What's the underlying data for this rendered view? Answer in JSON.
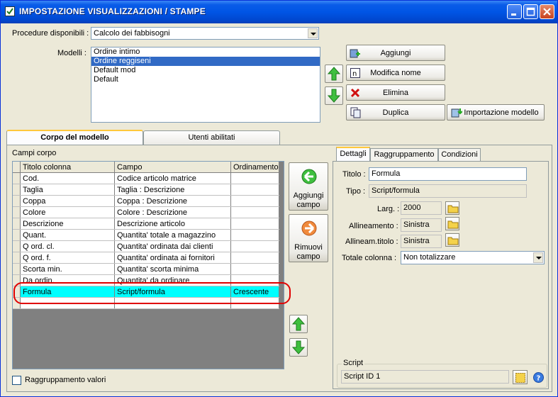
{
  "window": {
    "title": "IMPOSTAZIONE VISUALIZZAZIONI / STAMPE"
  },
  "procedure": {
    "label": "Procedure disponibili :",
    "value": "Calcolo dei fabbisogni"
  },
  "models": {
    "label": "Modelli :",
    "items": [
      "Ordine intimo",
      "Ordine reggiseni",
      "Default mod",
      "Default"
    ],
    "selected_index": 1
  },
  "buttons": {
    "add": "Aggiungi",
    "rename": "Modifica nome",
    "delete": "Elimina",
    "duplicate": "Duplica",
    "import": "Importazione modello",
    "add_field": "Aggiungi\ncampo",
    "remove_field": "Rimuovi\ncampo"
  },
  "tabs": {
    "body": "Corpo del modello",
    "users": "Utenti abilitati"
  },
  "fields_section": {
    "label": "Campi corpo"
  },
  "grid": {
    "columns": [
      "Titolo colonna",
      "Campo",
      "Ordinamento"
    ],
    "rows": [
      [
        "Cod.",
        "Codice articolo matrice",
        ""
      ],
      [
        "Taglia",
        "Taglia : Descrizione",
        ""
      ],
      [
        "Coppa",
        "Coppa : Descrizione",
        ""
      ],
      [
        "Colore",
        "Colore : Descrizione",
        ""
      ],
      [
        "Descrizione",
        "Descrizione articolo",
        ""
      ],
      [
        "Quant.",
        "Quantita' totale a magazzino",
        ""
      ],
      [
        "Q ord. cl.",
        "Quantita' ordinata dai clienti",
        ""
      ],
      [
        "Q ord. f.",
        "Quantita' ordinata ai fornitori",
        ""
      ],
      [
        "Scorta min.",
        "Quantita' scorta minima",
        ""
      ],
      [
        "Da ordin.",
        "Quantita' da ordinare",
        ""
      ],
      [
        "Formula",
        "Script/formula",
        "Crescente"
      ],
      [
        "",
        "",
        ""
      ]
    ],
    "selected_row": 10
  },
  "group_values": {
    "label": "Raggruppamento valori",
    "checked": false
  },
  "detail_tabs": [
    "Dettagli",
    "Raggruppamento",
    "Condizioni"
  ],
  "details": {
    "title_label": "Titolo :",
    "title_value": "Formula",
    "type_label": "Tipo :",
    "type_value": "Script/formula",
    "width_label": "Larg. :",
    "width_value": "2000",
    "align_label": "Allineamento :",
    "align_value": "Sinistra",
    "align_title_label": "Allineam.titolo :",
    "align_title_value": "Sinistra",
    "total_label": "Totale colonna :",
    "total_value": "Non totalizzare"
  },
  "script": {
    "group_label": "Script",
    "value": "Script ID 1"
  },
  "colors": {
    "selection": "#316ac5",
    "highlight_row": "#00ffff",
    "annotation": "#e00000"
  }
}
